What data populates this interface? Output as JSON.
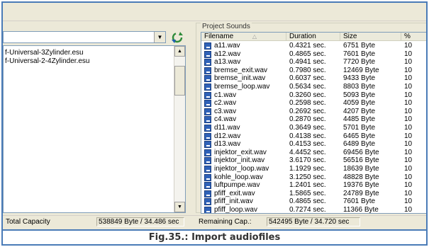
{
  "left": {
    "files": [
      "f-Universal-3Zylinder.esu",
      "f-Universal-2-4Zylinder.esu"
    ]
  },
  "project_sounds": {
    "title": "Project Sounds",
    "columns": [
      "Filename",
      "Duration",
      "Size",
      "%"
    ],
    "rows": [
      {
        "name": "a11.wav",
        "duration": "0.4321 sec.",
        "size": "6751 Byte",
        "pct": "10"
      },
      {
        "name": "a12.wav",
        "duration": "0.4865 sec.",
        "size": "7601 Byte",
        "pct": "10"
      },
      {
        "name": "a13.wav",
        "duration": "0.4941 sec.",
        "size": "7720 Byte",
        "pct": "10"
      },
      {
        "name": "bremse_exit.wav",
        "duration": "0.7980 sec.",
        "size": "12469 Byte",
        "pct": "10"
      },
      {
        "name": "bremse_init.wav",
        "duration": "0.6037 sec.",
        "size": "9433 Byte",
        "pct": "10"
      },
      {
        "name": "bremse_loop.wav",
        "duration": "0.5634 sec.",
        "size": "8803 Byte",
        "pct": "10"
      },
      {
        "name": "c1.wav",
        "duration": "0.3260 sec.",
        "size": "5093 Byte",
        "pct": "10"
      },
      {
        "name": "c2.wav",
        "duration": "0.2598 sec.",
        "size": "4059 Byte",
        "pct": "10"
      },
      {
        "name": "c3.wav",
        "duration": "0.2692 sec.",
        "size": "4207 Byte",
        "pct": "10"
      },
      {
        "name": "c4.wav",
        "duration": "0.2870 sec.",
        "size": "4485 Byte",
        "pct": "10"
      },
      {
        "name": "d11.wav",
        "duration": "0.3649 sec.",
        "size": "5701 Byte",
        "pct": "10"
      },
      {
        "name": "d12.wav",
        "duration": "0.4138 sec.",
        "size": "6465 Byte",
        "pct": "10"
      },
      {
        "name": "d13.wav",
        "duration": "0.4153 sec.",
        "size": "6489 Byte",
        "pct": "10"
      },
      {
        "name": "injektor_exit.wav",
        "duration": "4.4452 sec.",
        "size": "69456 Byte",
        "pct": "10"
      },
      {
        "name": "injektor_init.wav",
        "duration": "3.6170 sec.",
        "size": "56516 Byte",
        "pct": "10"
      },
      {
        "name": "injektor_loop.wav",
        "duration": "1.1929 sec.",
        "size": "18639 Byte",
        "pct": "10"
      },
      {
        "name": "kohle_loop.wav",
        "duration": "3.1250 sec.",
        "size": "48828 Byte",
        "pct": "10"
      },
      {
        "name": "luftpumpe.wav",
        "duration": "1.2401 sec.",
        "size": "19376 Byte",
        "pct": "10"
      },
      {
        "name": "pfiff_exit.wav",
        "duration": "1.5865 sec.",
        "size": "24789 Byte",
        "pct": "10"
      },
      {
        "name": "pfiff_init.wav",
        "duration": "0.4865 sec.",
        "size": "7601 Byte",
        "pct": "10"
      },
      {
        "name": "pfiff_loop.wav",
        "duration": "0.7274 sec.",
        "size": "11366 Byte",
        "pct": "10"
      }
    ]
  },
  "status": {
    "total_label": "Total Capacity",
    "total_value": "538849 Byte / 34.486 sec",
    "remaining_label": "Remaining Cap.:",
    "remaining_value": "542495 Byte / 34.720 sec"
  },
  "caption": "Fig.35.: Import audiofiles",
  "colors": {
    "frame": "#4a7bb7",
    "window_bg": "#ece9d8",
    "file_icon": "#2f62b8"
  },
  "icons": {
    "combo_arrow": "chevron-down-icon",
    "refresh": "refresh-icon",
    "file": "wav-file-icon"
  }
}
